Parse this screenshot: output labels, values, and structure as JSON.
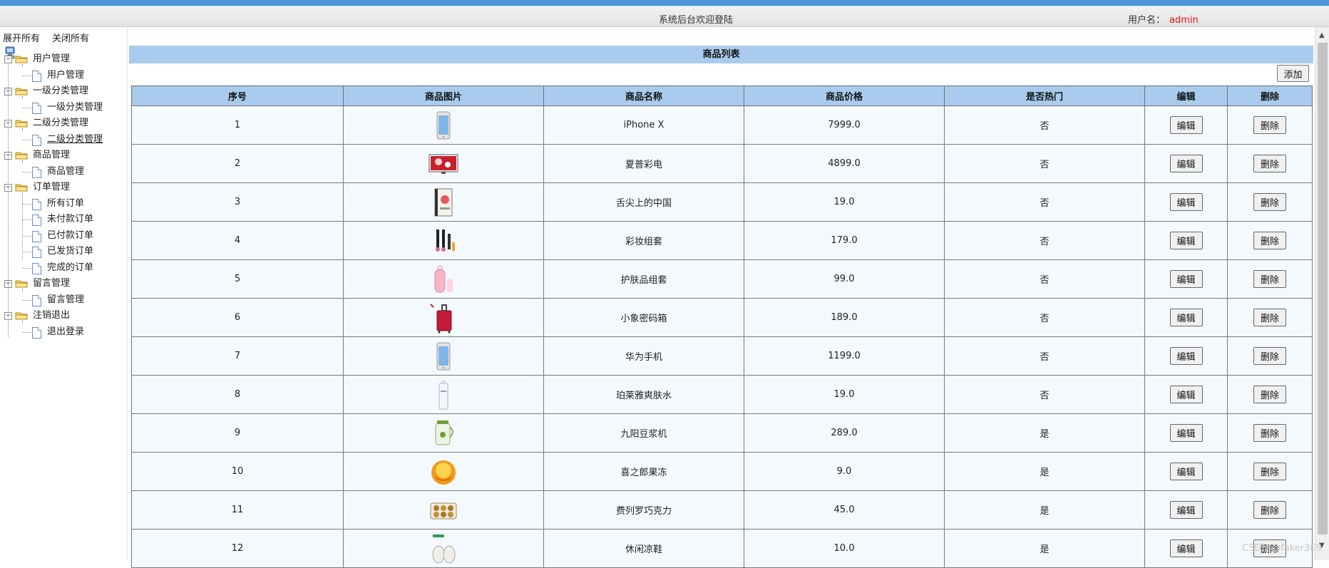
{
  "header": {
    "welcome": "系统后台欢迎登陆",
    "user_label": "用户名：",
    "user_name": "admin"
  },
  "sidebar": {
    "expand_all": "展开所有",
    "collapse_all": "关闭所有",
    "groups": [
      {
        "label": "用户管理",
        "children": [
          "用户管理"
        ]
      },
      {
        "label": "一级分类管理",
        "children": [
          "一级分类管理"
        ]
      },
      {
        "label": "二级分类管理",
        "children": [
          "二级分类管理"
        ]
      },
      {
        "label": "商品管理",
        "children": [
          "商品管理"
        ]
      },
      {
        "label": "订单管理",
        "children": [
          "所有订单",
          "未付款订单",
          "已付款订单",
          "已发货订单",
          "完成的订单"
        ]
      },
      {
        "label": "留言管理",
        "children": [
          "留言管理"
        ]
      },
      {
        "label": "注销退出",
        "children": [
          "退出登录"
        ]
      }
    ]
  },
  "main": {
    "title": "商品列表",
    "add_label": "添加",
    "columns": [
      "序号",
      "商品图片",
      "商品名称",
      "商品价格",
      "是否热门",
      "编辑",
      "删除"
    ],
    "edit_label": "编辑",
    "delete_label": "删除",
    "rows": [
      {
        "id": "1",
        "name": "iPhone X",
        "price": "7999.0",
        "hot": "否",
        "image": "phone-thumbnail"
      },
      {
        "id": "2",
        "name": "夏普彩电",
        "price": "4899.0",
        "hot": "否",
        "image": "tv-thumbnail"
      },
      {
        "id": "3",
        "name": "舌尖上的中国",
        "price": "19.0",
        "hot": "否",
        "image": "book-thumbnail"
      },
      {
        "id": "4",
        "name": "彩妆组套",
        "price": "179.0",
        "hot": "否",
        "image": "makeup-thumbnail"
      },
      {
        "id": "5",
        "name": "护肤品组套",
        "price": "99.0",
        "hot": "否",
        "image": "skincare-thumbnail"
      },
      {
        "id": "6",
        "name": "小象密码箱",
        "price": "189.0",
        "hot": "否",
        "image": "suitcase-thumbnail"
      },
      {
        "id": "7",
        "name": "华为手机",
        "price": "1199.0",
        "hot": "否",
        "image": "phone-thumbnail"
      },
      {
        "id": "8",
        "name": "珀莱雅爽肤水",
        "price": "19.0",
        "hot": "否",
        "image": "toner-thumbnail"
      },
      {
        "id": "9",
        "name": "九阳豆浆机",
        "price": "289.0",
        "hot": "是",
        "image": "soymilk-maker-thumbnail"
      },
      {
        "id": "10",
        "name": "喜之郎果冻",
        "price": "9.0",
        "hot": "是",
        "image": "jelly-thumbnail"
      },
      {
        "id": "11",
        "name": "费列罗巧克力",
        "price": "45.0",
        "hot": "是",
        "image": "chocolate-thumbnail"
      },
      {
        "id": "12",
        "name": "休闲凉鞋",
        "price": "10.0",
        "hot": "是",
        "image": "sandals-thumbnail"
      }
    ]
  },
  "watermark": "CSDN @faker369",
  "colors": {
    "accent": "#4e95d9",
    "table_header": "#a9ccee",
    "username": "#e01515"
  }
}
